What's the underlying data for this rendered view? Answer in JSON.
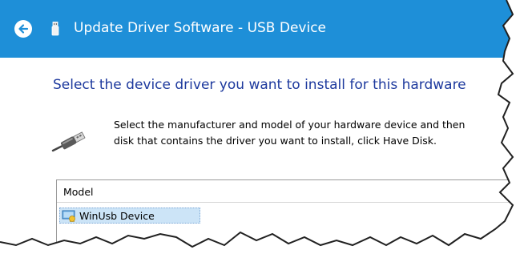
{
  "window": {
    "title": "Update Driver Software - USB Device",
    "title_icon": "usb-plug-icon",
    "back_icon": "back-arrow-icon"
  },
  "main": {
    "heading": "Select the device driver you want to install for this hardware",
    "instruction_line1": "Select the manufacturer and model of your hardware device and then",
    "instruction_line2": "disk that contains the driver you want to install, click Have Disk.",
    "instruction_icon": "usb-cable-icon"
  },
  "model_list": {
    "header": "Model",
    "items": [
      {
        "label": "WinUsb Device",
        "icon": "driver-certified-icon",
        "selected": true
      }
    ]
  },
  "colors": {
    "titlebar": "#1e8fd8",
    "heading": "#1e3a9e",
    "selection": "#cce4f7"
  }
}
